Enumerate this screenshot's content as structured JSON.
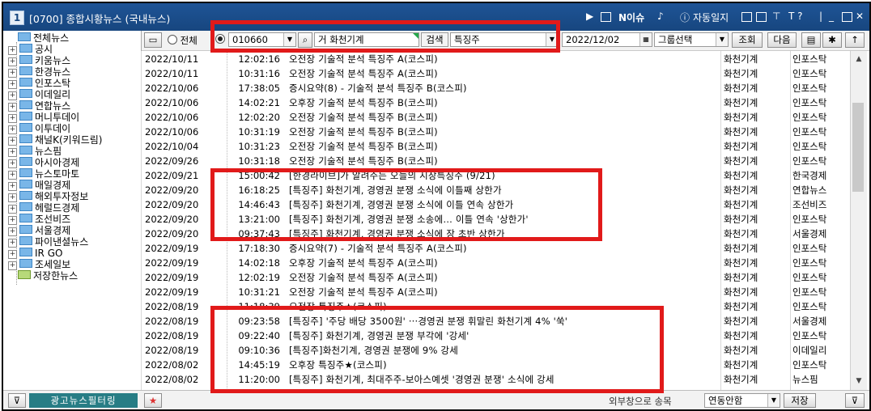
{
  "window": {
    "app_number": "1",
    "title": "[0700] 종합시황뉴스 (국내뉴스)",
    "issue_label": "N이슈",
    "auto_log_label": "자동일지",
    "help_label": "T ?"
  },
  "toolbar": {
    "radio_all_label": "전체",
    "stock_code": "010660",
    "stock_tag": "거",
    "stock_name": "화천기계",
    "search_label": "검색",
    "search_type": "특징주",
    "date": "2022/12/02",
    "group_select": "그룹선택",
    "query_button": "조회",
    "next_button": "다음"
  },
  "tree": {
    "items": [
      {
        "label": "전체뉴스",
        "type": "root"
      },
      {
        "label": "공시",
        "type": "folder"
      },
      {
        "label": "키움뉴스",
        "type": "folder"
      },
      {
        "label": "한경뉴스",
        "type": "folder"
      },
      {
        "label": "인포스탁",
        "type": "folder"
      },
      {
        "label": "이데일리",
        "type": "folder"
      },
      {
        "label": "연합뉴스",
        "type": "folder"
      },
      {
        "label": "머니투데이",
        "type": "folder"
      },
      {
        "label": "이투데이",
        "type": "folder"
      },
      {
        "label": "채널K(키워드림)",
        "type": "folder"
      },
      {
        "label": "뉴스핌",
        "type": "folder"
      },
      {
        "label": "아시아경제",
        "type": "folder"
      },
      {
        "label": "뉴스토마토",
        "type": "folder"
      },
      {
        "label": "매일경제",
        "type": "folder"
      },
      {
        "label": "해외투자정보",
        "type": "folder"
      },
      {
        "label": "헤럴드경제",
        "type": "folder"
      },
      {
        "label": "조선비즈",
        "type": "folder"
      },
      {
        "label": "서울경제",
        "type": "folder"
      },
      {
        "label": "파이낸셜뉴스",
        "type": "folder"
      },
      {
        "label": "IR GO",
        "type": "folder"
      },
      {
        "label": "조세일보",
        "type": "folder"
      },
      {
        "label": "저장한뉴스",
        "type": "saved"
      }
    ]
  },
  "news": {
    "rows": [
      {
        "date": "2022/10/11",
        "time": "12:02:16",
        "title": "오전장 기술적 분석 특징주 A(코스피)",
        "company": "화천기계",
        "source": "인포스탁"
      },
      {
        "date": "2022/10/11",
        "time": "10:31:16",
        "title": "오전장 기술적 분석 특징주 A(코스피)",
        "company": "화천기계",
        "source": "인포스탁"
      },
      {
        "date": "2022/10/06",
        "time": "17:38:05",
        "title": "증시요약(8) - 기술적 분석 특징주 B(코스피)",
        "company": "화천기계",
        "source": "인포스탁"
      },
      {
        "date": "2022/10/06",
        "time": "14:02:21",
        "title": "오후장 기술적 분석 특징주 B(코스피)",
        "company": "화천기계",
        "source": "인포스탁"
      },
      {
        "date": "2022/10/06",
        "time": "12:02:20",
        "title": "오전장 기술적 분석 특징주 B(코스피)",
        "company": "화천기계",
        "source": "인포스탁"
      },
      {
        "date": "2022/10/06",
        "time": "10:31:19",
        "title": "오전장 기술적 분석 특징주 B(코스피)",
        "company": "화천기계",
        "source": "인포스탁"
      },
      {
        "date": "2022/10/04",
        "time": "10:31:23",
        "title": "오전장 기술적 분석 특징주 B(코스피)",
        "company": "화천기계",
        "source": "인포스탁"
      },
      {
        "date": "2022/09/26",
        "time": "10:31:18",
        "title": "오전장 기술적 분석 특징주 B(코스피)",
        "company": "화천기계",
        "source": "인포스탁"
      },
      {
        "date": "2022/09/21",
        "time": "15:00:42",
        "title": "[한경라이브]가 알려주는 오늘의 시장특징주 (9/21)",
        "company": "화천기계",
        "source": "한국경제"
      },
      {
        "date": "2022/09/20",
        "time": "16:18:25",
        "title": "[특징주] 화천기계, 경영권 분쟁 소식에 이틀째 상한가",
        "company": "화천기계",
        "source": "연합뉴스"
      },
      {
        "date": "2022/09/20",
        "time": "14:46:43",
        "title": "[특징주] 화천기계, 경영권 분쟁 소식에 이틀 연속 상한가",
        "company": "화천기계",
        "source": "조선비즈"
      },
      {
        "date": "2022/09/20",
        "time": "13:21:00",
        "title": "[특징주] 화천기계, 경영권 분쟁 소송에… 이틀 연속 '상한가'",
        "company": "화천기계",
        "source": "인포스탁"
      },
      {
        "date": "2022/09/20",
        "time": "09:37:43",
        "title": "[특징주] 화천기계, 경영권 분쟁 소식에 장 초반 상한가",
        "company": "화천기계",
        "source": "서울경제"
      },
      {
        "date": "2022/09/19",
        "time": "17:18:30",
        "title": "증시요약(7) - 기술적 분석 특징주 A(코스피)",
        "company": "화천기계",
        "source": "인포스탁"
      },
      {
        "date": "2022/09/19",
        "time": "14:02:18",
        "title": "오후장 기술적 분석 특징주 A(코스피)",
        "company": "화천기계",
        "source": "인포스탁"
      },
      {
        "date": "2022/09/19",
        "time": "12:02:19",
        "title": "오전장 기술적 분석 특징주 A(코스피)",
        "company": "화천기계",
        "source": "인포스탁"
      },
      {
        "date": "2022/09/19",
        "time": "10:31:21",
        "title": "오전장 기술적 분석 특징주 A(코스피)",
        "company": "화천기계",
        "source": "인포스탁"
      },
      {
        "date": "2022/08/19",
        "time": "11:18:39",
        "title": "오전장 특징주★(코스피)",
        "company": "화천기계",
        "source": "인포스탁"
      },
      {
        "date": "2022/08/19",
        "time": "09:23:58",
        "title": "[특징주] '주당 배당 3500원' ···경영권 분쟁 휘말린 화천기계 4% '쑥'",
        "company": "화천기계",
        "source": "서울경제"
      },
      {
        "date": "2022/08/19",
        "time": "09:22:40",
        "title": "[특징주] 화천기계, 경영권 분쟁 부각에 '강세'",
        "company": "화천기계",
        "source": "인포스탁"
      },
      {
        "date": "2022/08/19",
        "time": "09:10:36",
        "title": "[특징주]화천기계, 경영권 분쟁에 9% 강세",
        "company": "화천기계",
        "source": "이데일리"
      },
      {
        "date": "2022/08/02",
        "time": "14:45:19",
        "title": "오후장 특징주★(코스피)",
        "company": "화천기계",
        "source": "인포스탁"
      },
      {
        "date": "2022/08/02",
        "time": "11:20:00",
        "title": "[특징주] 화천기계, 최대주주-보아스예셋 '경영권 분쟁' 소식에 강세",
        "company": "화천기계",
        "source": "뉴스핌"
      }
    ]
  },
  "bottom": {
    "ad_filter_button": "광고뉴스필터링",
    "external_label": "외부창으로 송목",
    "link_select": "연동안함",
    "save_button": "저장"
  },
  "colors": {
    "titlebar": "#1e5496",
    "annotation": "#e11a1a",
    "ad_button": "#277d85"
  }
}
